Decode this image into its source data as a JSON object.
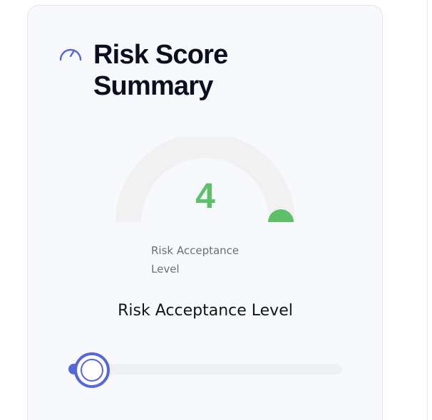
{
  "card": {
    "title": "Risk Score Summary",
    "icon": "gauge-icon"
  },
  "gauge": {
    "value": "4",
    "value_fraction": 0.4,
    "caption": "Risk Acceptance Level",
    "colors": {
      "track": "#f1f1f1",
      "indicator": "#5fc06b"
    }
  },
  "slider": {
    "label": "Risk Acceptance Level",
    "level_fraction": 0.02,
    "accent": "#5467dc"
  }
}
